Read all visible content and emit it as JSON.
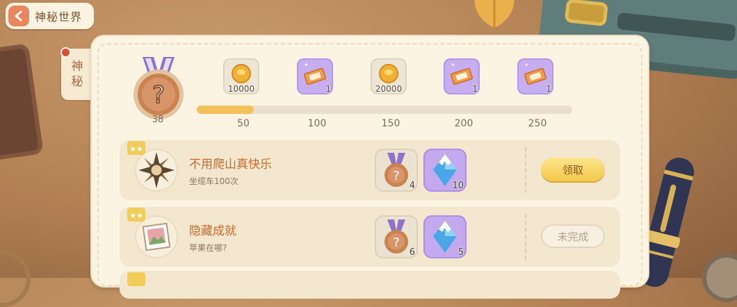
{
  "header": {
    "back_title": "神秘世界"
  },
  "side_tab": {
    "label_line1": "神",
    "label_line2": "秘",
    "has_notification": true
  },
  "medal": {
    "count": "38"
  },
  "progress": {
    "current": 38,
    "max": 250,
    "milestones": [
      {
        "threshold": "50",
        "reward_type": "gold-coin",
        "quantity": "10000"
      },
      {
        "threshold": "100",
        "reward_type": "ticket",
        "quantity": "1"
      },
      {
        "threshold": "150",
        "reward_type": "gold-coin",
        "quantity": "20000"
      },
      {
        "threshold": "200",
        "reward_type": "ticket",
        "quantity": "1"
      },
      {
        "threshold": "250",
        "reward_type": "ticket",
        "quantity": "1"
      }
    ]
  },
  "tasks": [
    {
      "title": "不用爬山真快乐",
      "subtitle": "坐缆车100次",
      "icon": "compass-star-icon",
      "rewards": [
        {
          "type": "medal",
          "quantity": "4"
        },
        {
          "type": "crystal",
          "quantity": "10"
        }
      ],
      "action": "领取",
      "state": "claimable"
    },
    {
      "title": "隐藏成就",
      "subtitle": "苹果在哪?",
      "icon": "picture-frame-icon",
      "rewards": [
        {
          "type": "medal",
          "quantity": "6"
        },
        {
          "type": "crystal",
          "quantity": "5"
        }
      ],
      "action": "未完成",
      "state": "incomplete"
    }
  ],
  "colors": {
    "accent_orange": "#c76b2c",
    "claim_yellow": "#f3c84c",
    "progress_fill": "#f2c15b",
    "ticket_purple": "#c6aef0"
  }
}
